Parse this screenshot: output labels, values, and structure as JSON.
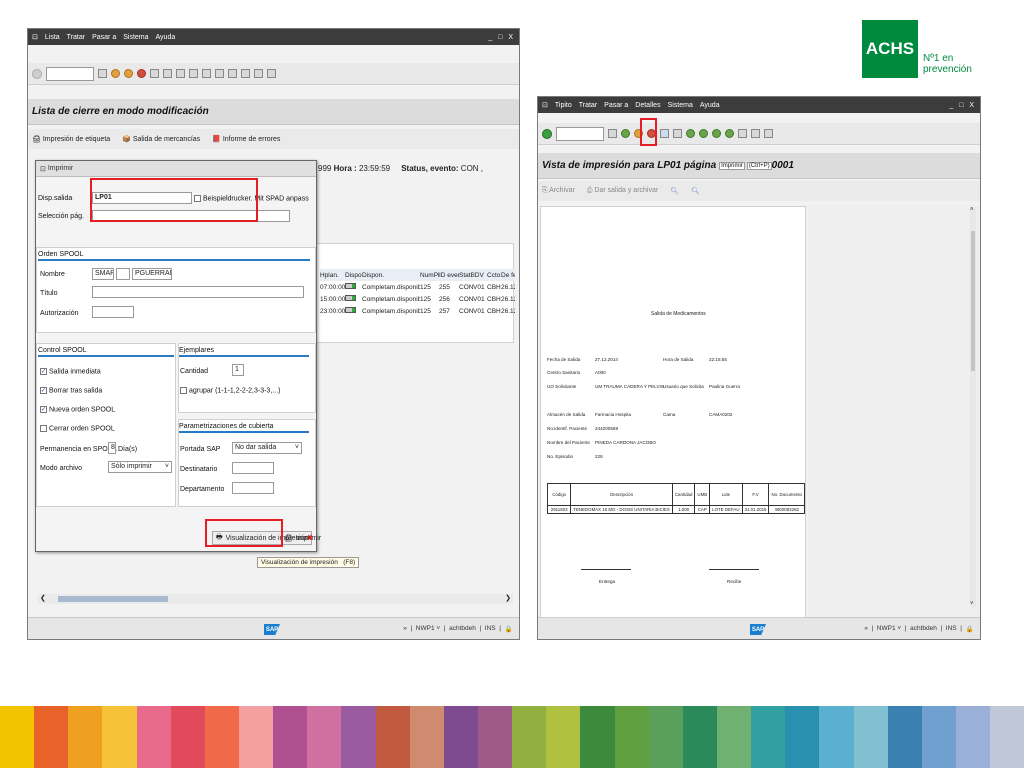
{
  "logo": {
    "brand": "ACHS",
    "tagline_line1": "Nº1 en",
    "tagline_line2": "prevención",
    "color": "#008a3e"
  },
  "left_window": {
    "menu": [
      "Lista",
      "Tratar",
      "Pasar a",
      "Sistema",
      "Ayuda"
    ],
    "window_controls": "_ □ X",
    "title": "Lista de cierre en modo modificación",
    "app_toolbar": [
      "Impresión de etiqueta",
      "Salida de mercancías",
      "Informe de errores"
    ],
    "bg_header": {
      "hora_prefix": "999",
      "hora_label": "Hora :",
      "hora_value": "23:59:59",
      "status_label": "Status, evento:",
      "status_value": "CON ,"
    },
    "table": {
      "headers": [
        "Hplan.",
        "Dispon.",
        "Dispon.",
        "NumPi.",
        "ID even.",
        "StatEv",
        "IDV",
        "Ccto",
        "De fe"
      ],
      "rows": [
        [
          "07:00:00",
          "Completam.disponible",
          "125",
          "255",
          "CON",
          "V01",
          "CBH",
          "26.12"
        ],
        [
          "15:00:00",
          "Completam.disponible",
          "125",
          "256",
          "CON",
          "V01",
          "CBH",
          "26.12"
        ],
        [
          "23:00:00",
          "Completam.disponible",
          "125",
          "257",
          "CON",
          "V01",
          "CBH",
          "26.12"
        ]
      ]
    },
    "tooltip": "Visualización de impresión   (F8)",
    "status_bar": "»  |  NWP1 ˅  |  achtbdeh  |  INS  |"
  },
  "print_dialog": {
    "title": "Imprimir",
    "disp_salida_label": "Disp.salida",
    "disp_salida_value": "LP01",
    "disp_desc": "Beispieldrucker. Mit SPAD anpass",
    "seleccion_label": "Selección pág.",
    "orden_spool_head": "Orden SPOOL",
    "nombre_label": "Nombre",
    "nombre_val1": "SMART",
    "nombre_val2": "PGUERRAM",
    "titulo_label": "Título",
    "autorizacion_label": "Autorización",
    "control_head": "Control SPOOL",
    "salida_inmediata": "Salida inmediata",
    "borrar_tras_salida": "Borrar tras salida",
    "nueva_orden": "Nueva orden SPOOL",
    "cerrar_orden": "Cerrar orden SPOOL",
    "permanencia_label": "Permanencia en SPOOL",
    "permanencia_value": "8",
    "permanencia_unit": "Día(s)",
    "modo_archivo_label": "Modo archivo",
    "modo_archivo_value": "Sólo imprimir",
    "ejemplares_head": "Ejemplares",
    "cantidad_label": "Cantidad",
    "cantidad_value": "1",
    "agrupar_label": "agrupar (1-1-1,2-2-2,3-3-3,...)",
    "cubierta_head": "Parametrizaciones de cubierta",
    "portada_label": "Portada SAP",
    "portada_value": "No dar salida",
    "destinatario_label": "Destinatario",
    "departamento_label": "Departamento",
    "btn_preview": "Visualización de impresión",
    "btn_print": "Imprimir",
    "btn_cancel": "✖"
  },
  "right_window": {
    "menu": [
      "Tipito",
      "Tratar",
      "Pasar a",
      "Detalles",
      "Sistema",
      "Ayuda"
    ],
    "window_controls": "_ □ X",
    "title": "Vista de impresión para LP01 página",
    "page_chip_1": "Imprimir",
    "page_chip_2": "(Ctrl+P)",
    "page_suffix": "0001",
    "app_toolbar": [
      "Archivar",
      "Dar salida y archivar"
    ],
    "status_bar": "»  |  NWP1 ˅  |  achtbdeh  |  INS  |"
  },
  "document": {
    "heading": "Salida de Medicamentos",
    "fields_left": [
      {
        "label": "Fecha de Salida",
        "value": "27.12.2014"
      },
      {
        "label": "Centro Sanitario",
        "value": "A000"
      },
      {
        "label": "UO Solicitante",
        "value": "UM TRAUMA CADERA Y PELVIS"
      },
      {
        "label": "Almacén de Salida",
        "value": "Farmacia Hospita"
      },
      {
        "label": "No.Identif. Paciente",
        "value": "244200569"
      },
      {
        "label": "Nombre del Paciente",
        "value": "PINEDA CARDONA JACOBO"
      },
      {
        "label": "No. Episodio",
        "value": "228"
      }
    ],
    "fields_right": [
      {
        "label": "Hora de Salida",
        "value": "22:16:55"
      },
      {
        "label": "Usuario que Solicita",
        "value": "Paulina Guerra"
      },
      {
        "label": "Cama",
        "value": "CAMA0202"
      }
    ],
    "table_headers": [
      "Código",
      "Descripción",
      "Cantidad",
      "UMB",
      "Lote",
      "F.V",
      "No. Documento"
    ],
    "table_row": [
      "2911503",
      "TENEDOMAX 10 MG - DOSIS UNITARIA BICIES",
      "1.000",
      "CAP",
      "LOTE DEFAU",
      "31.01.2015",
      "4900083282"
    ],
    "entrega": "Entrega",
    "recibe": "Recibe"
  },
  "stripe_colors": [
    "#f2c400",
    "#e8622a",
    "#f0a020",
    "#f5c238",
    "#e86a8a",
    "#e04a5a",
    "#f06a4a",
    "#f5a0a0",
    "#b05090",
    "#d070a0",
    "#9a5aa0",
    "#c25a40",
    "#d08a70",
    "#7e4a90",
    "#a05a8a",
    "#90b040",
    "#b0c040",
    "#3c8a3c",
    "#60a040",
    "#5aa05a",
    "#2a8a5a",
    "#70b070",
    "#30a0a0",
    "#2a90b0",
    "#5ab0d0",
    "#80c0d0",
    "#3a80b0",
    "#70a0d0",
    "#9ab0d8",
    "#c0c8d8"
  ]
}
